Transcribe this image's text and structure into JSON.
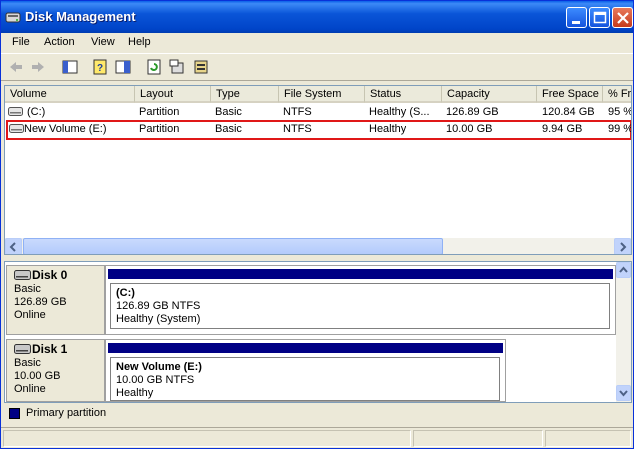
{
  "window": {
    "title": "Disk Management"
  },
  "menu": [
    "File",
    "Action",
    "View",
    "Help"
  ],
  "columns": [
    "Volume",
    "Layout",
    "Type",
    "File System",
    "Status",
    "Capacity",
    "Free Space",
    "% Fr"
  ],
  "volumes": [
    {
      "volume": "(C:)",
      "layout": "Partition",
      "type": "Basic",
      "fs": "NTFS",
      "status": "Healthy (S...",
      "capacity": "126.89 GB",
      "free": "120.84 GB",
      "pct": "95 %"
    },
    {
      "volume": "New Volume (E:)",
      "layout": "Partition",
      "type": "Basic",
      "fs": "NTFS",
      "status": "Healthy",
      "capacity": "10.00 GB",
      "free": "9.94 GB",
      "pct": "99 %"
    }
  ],
  "disks": [
    {
      "name": "Disk 0",
      "type": "Basic",
      "size": "126.89 GB",
      "state": "Online",
      "vol_title": "(C:)",
      "vol_size": "126.89 GB NTFS",
      "vol_status": "Healthy (System)"
    },
    {
      "name": "Disk 1",
      "type": "Basic",
      "size": "10.00 GB",
      "state": "Online",
      "vol_title": "New Volume  (E:)",
      "vol_size": "10.00 GB NTFS",
      "vol_status": "Healthy"
    }
  ],
  "legend": {
    "primary": "Primary partition"
  },
  "colors": {
    "primary_partition": "#000084",
    "highlight_outline": "#e01818",
    "title_bar": "#0a55d8"
  },
  "icons": [
    "disk-management-icon",
    "back-icon",
    "forward-icon",
    "show-hide-tree-icon",
    "help-icon",
    "properties-icon",
    "refresh-icon",
    "settings-icon",
    "rescan-icon"
  ]
}
